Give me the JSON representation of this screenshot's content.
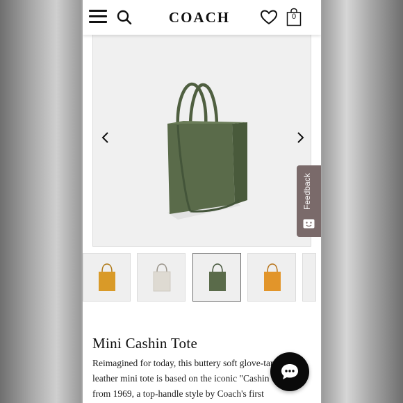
{
  "header": {
    "brand": "COACH",
    "bag_count": "0",
    "icons": [
      "menu-icon",
      "search-icon",
      "heart-icon",
      "shopping-bag-icon"
    ]
  },
  "gallery": {
    "main_color": "#5a6b4a",
    "thumbnails": [
      {
        "name": "mustard",
        "color": "#d99a28"
      },
      {
        "name": "chalk",
        "color": "#dedad2"
      },
      {
        "name": "army-green",
        "color": "#5a6b4a"
      },
      {
        "name": "orange",
        "color": "#e2952a"
      }
    ],
    "active_thumbnail": 2
  },
  "product": {
    "title": "Mini Cashin Tote",
    "description": "Reimagined for today, this buttery soft glove-tanned leather mini tote is based on the iconic \"Cashin Carry\" from 1969, a top-handle style by Coach's first"
  },
  "feedback": {
    "label": "Feedback",
    "color": "#7a6a6a"
  },
  "chat": {
    "icon": "chat-bubble-icon"
  }
}
